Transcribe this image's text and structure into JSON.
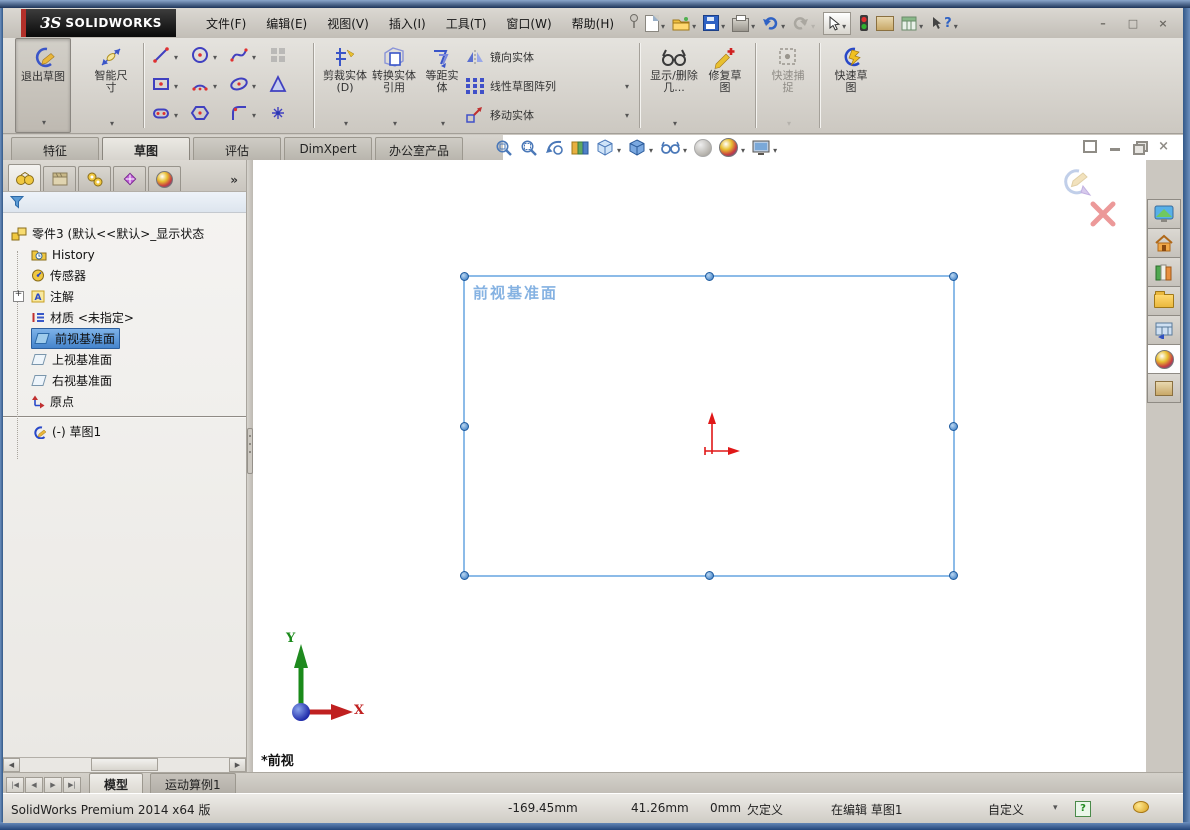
{
  "titlebar": {
    "logo_prefix": "3S",
    "logo_name": "SOLIDWORKS",
    "menus": [
      "文件(F)",
      "编辑(E)",
      "视图(V)",
      "插入(I)",
      "工具(T)",
      "窗口(W)",
      "帮助(H)"
    ]
  },
  "command_manager": {
    "exit_sketch": "退出草图",
    "smart_dimension": "智能尺寸",
    "trim_entities": "剪裁实体(D)",
    "convert_entities": "转换实体引用",
    "offset_entities": "等距实体",
    "mirror_entities": "镜向实体",
    "linear_sketch_pattern": "线性草图阵列",
    "move_entities": "移动实体",
    "display_delete_relations": "显示/删除几...",
    "repair_sketch": "修复草图",
    "quick_snaps": "快速捕捉",
    "rapid_sketch": "快速草图"
  },
  "ribbon_tabs": [
    {
      "label": "特征"
    },
    {
      "label": "草图"
    },
    {
      "label": "评估"
    },
    {
      "label": "DimXpert"
    },
    {
      "label": "办公室产品"
    }
  ],
  "feature_tree": {
    "root_label": "零件3 (默认<<默认>_显示状态",
    "items": [
      {
        "label": "History"
      },
      {
        "label": "传感器"
      },
      {
        "label": "注解"
      },
      {
        "label": "材质 <未指定>"
      },
      {
        "label": "前视基准面"
      },
      {
        "label": "上视基准面"
      },
      {
        "label": "右视基准面"
      },
      {
        "label": "原点"
      },
      {
        "label": "(-) 草图1"
      }
    ]
  },
  "viewport": {
    "plane_label": "前视基准面",
    "view_orientation": "*前视",
    "triad": {
      "x": "X",
      "y": "Y"
    }
  },
  "document_tabs": [
    {
      "label": "模型"
    },
    {
      "label": "运动算例1"
    }
  ],
  "status_bar": {
    "version": "SolidWorks Premium 2014 x64 版",
    "x": "-169.45mm",
    "y": "41.26mm",
    "z": "0mm",
    "definition": "欠定义",
    "editing": "在编辑 草图1",
    "units": "自定义"
  },
  "colors": {
    "selection_blue": "#4584cc",
    "plane_outline": "#8cbbe8",
    "origin_red": "#e01818",
    "triad_green": "#1a8a1a",
    "triad_red": "#c02020"
  }
}
